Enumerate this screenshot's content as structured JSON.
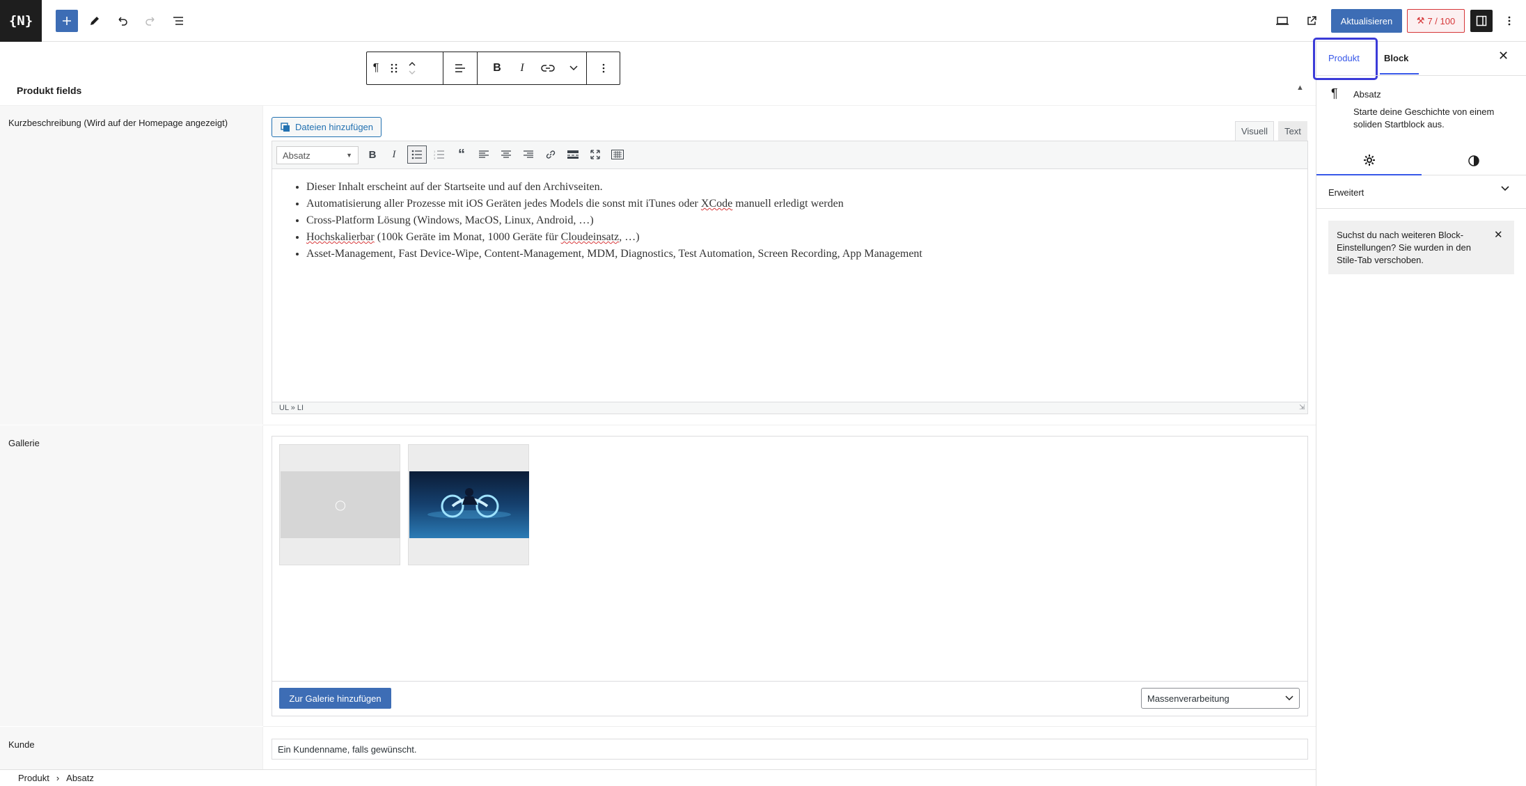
{
  "topbar": {
    "logo_text": "{N}",
    "update_label": "Aktualisieren",
    "score_label": "7 / 100",
    "icons": [
      "plus-icon",
      "pencil-icon",
      "undo-icon",
      "redo-icon",
      "list-view-icon",
      "desktop-icon",
      "external-link-icon",
      "sidebar-icon",
      "more-vertical-icon"
    ]
  },
  "block_toolbar": {
    "icons": [
      "paragraph-icon",
      "drag-handle-icon",
      "move-updown-icon",
      "align-icon",
      "bold-icon",
      "italic-icon",
      "link-icon",
      "chevron-down-icon",
      "more-vertical-icon"
    ]
  },
  "metabox": {
    "title": "Produkt fields",
    "short_desc_label": "Kurzbeschreibung (Wird auf der Homepage angezeigt)",
    "add_media_label": "Dateien hinzufügen",
    "tab_visual": "Visuell",
    "tab_text": "Text",
    "format_select": "Absatz",
    "content_items": [
      "Dieser Inhalt erscheint auf der Startseite und auf den Archivseiten.",
      "Automatisierung aller Prozesse mit iOS Geräten jedes Models die sonst mit iTunes oder XCode manuell erledigt werden",
      "Cross-Platform Lösung (Windows, MacOS, Linux, Android, …)",
      "Hochskalierbar (100k Geräte im Monat, 1000 Geräte für Cloudeinsatz, …)",
      "Asset-Management, Fast Device-Wipe, Content-Management, MDM, Diagnostics, Test Automation, Screen Recording, App Management"
    ],
    "path": "UL » LI",
    "gallery_label": "Gallerie",
    "add_gallery_label": "Zur Galerie hinzufügen",
    "bulk_select": "Massenverarbeitung",
    "customer_label": "Kunde",
    "customer_value": "Ein Kundenname, falls gewünscht."
  },
  "breadcrumb": {
    "root": "Produkt",
    "sep": "›",
    "current": "Absatz"
  },
  "sidebar": {
    "tab_produkt": "Produkt",
    "tab_block": "Block",
    "block_title": "Absatz",
    "block_desc": "Starte deine Geschichte von einem soliden Startblock aus.",
    "advanced_label": "Erweitert",
    "notice_text": "Suchst du nach weiteren Block-Einstellungen? Sie wurden in den Stile-Tab verschoben."
  },
  "colors": {
    "accent": "#3858e9",
    "primary_button": "#3d6db5",
    "score_red": "#d63638",
    "highlight": "#3b3bd8"
  }
}
